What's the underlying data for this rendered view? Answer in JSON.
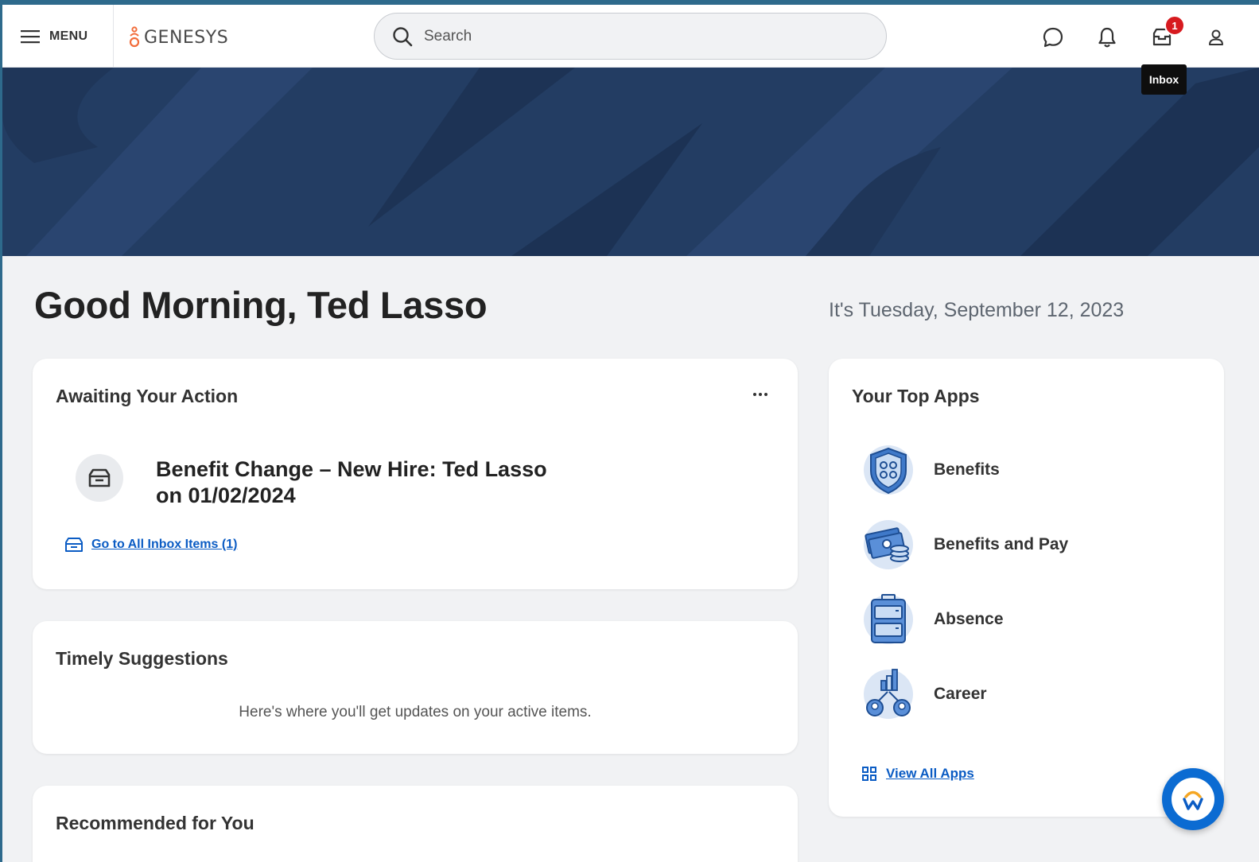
{
  "header": {
    "menu_label": "MENU",
    "logo_text": "GENESYS",
    "search_placeholder": "Search",
    "inbox_badge": "1",
    "inbox_tooltip": "Inbox"
  },
  "greeting": "Good Morning, Ted Lasso",
  "date": "It's Tuesday, September 12, 2023",
  "awaiting": {
    "title": "Awaiting Your Action",
    "task_title": "Benefit Change – New Hire: Ted Lasso on 01/02/2024",
    "link_label": "Go to All Inbox Items (1)"
  },
  "suggestions": {
    "title": "Timely Suggestions",
    "text": "Here's where you'll get updates on your active items."
  },
  "recommended": {
    "title": "Recommended for You"
  },
  "top_apps": {
    "title": "Your Top Apps",
    "apps": [
      {
        "label": "Benefits"
      },
      {
        "label": "Benefits and Pay"
      },
      {
        "label": "Absence"
      },
      {
        "label": "Career"
      }
    ],
    "view_all_label": "View All Apps"
  },
  "colors": {
    "banner": "#233d63",
    "link": "#0b5cc4",
    "badge": "#d71a1f",
    "accent_orange": "#f26c3a",
    "fab": "#0b6bd2"
  }
}
